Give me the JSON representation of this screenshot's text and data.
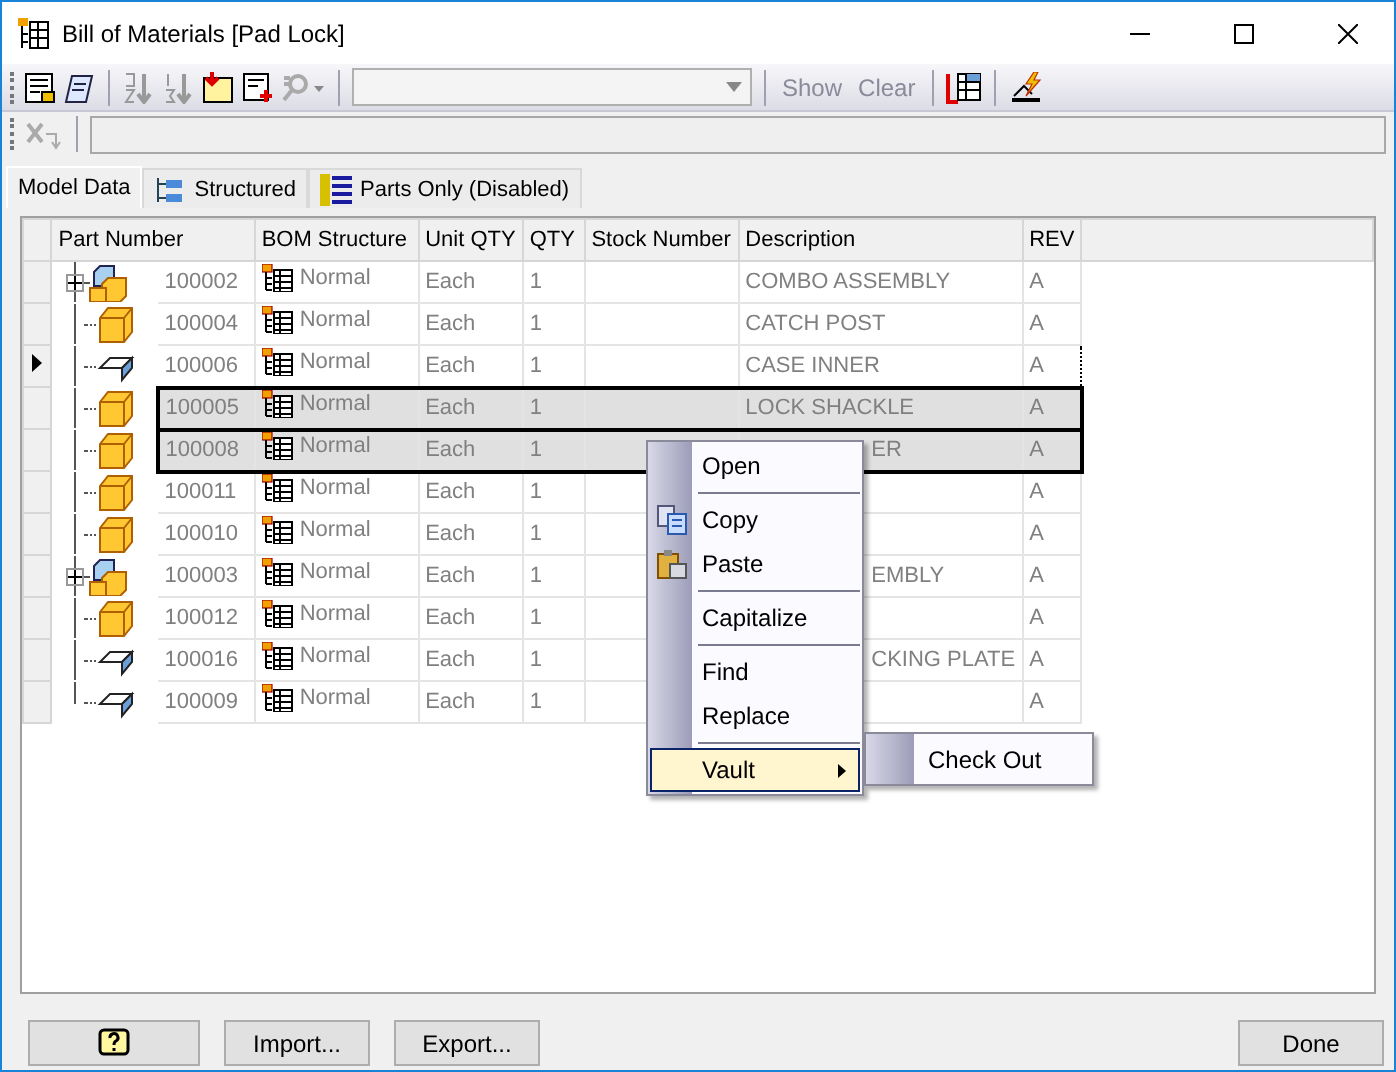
{
  "window": {
    "title": "Bill of Materials [Pad Lock]"
  },
  "toolbar": {
    "buttons": [
      {
        "label": "Show",
        "disabled": true
      },
      {
        "label": "Clear",
        "disabled": true
      }
    ]
  },
  "tabs": [
    {
      "label": "Model Data",
      "kind": "plain",
      "selected": true
    },
    {
      "label": "Structured",
      "kind": "tree",
      "selected": false
    },
    {
      "label": "Parts Only (Disabled)",
      "kind": "list",
      "selected": false
    }
  ],
  "table": {
    "columns": [
      "Part Number",
      "BOM Structure",
      "Unit QTY",
      "QTY",
      "Stock Number",
      "Description",
      "REV"
    ],
    "rows": [
      {
        "kind": "assembly",
        "expanded": false,
        "part": "100002",
        "bom": "Normal",
        "unit": "Each",
        "qty": "1",
        "description": "COMBO ASSEMBLY",
        "desc_covered": false,
        "rev": "A",
        "selected": false,
        "current": false
      },
      {
        "kind": "part",
        "part": "100004",
        "bom": "Normal",
        "unit": "Each",
        "qty": "1",
        "description": "CATCH POST",
        "desc_covered": false,
        "rev": "A",
        "selected": false,
        "current": false
      },
      {
        "kind": "sheet",
        "part": "100006",
        "bom": "Normal",
        "unit": "Each",
        "qty": "1",
        "description": "CASE INNER",
        "desc_covered": false,
        "rev": "A",
        "selected": false,
        "current": true
      },
      {
        "kind": "part",
        "part": "100005",
        "bom": "Normal",
        "unit": "Each",
        "qty": "1",
        "description": "LOCK SHACKLE",
        "desc_covered": false,
        "rev": "A",
        "selected": true,
        "current": false
      },
      {
        "kind": "part",
        "part": "100008",
        "bom": "Normal",
        "unit": "Each",
        "qty": "1",
        "description": "ER",
        "desc_covered": true,
        "rev": "A",
        "selected": true,
        "current": false
      },
      {
        "kind": "part",
        "part": "100011",
        "bom": "Normal",
        "unit": "Each",
        "qty": "1",
        "rev": "A",
        "selected": false,
        "current": false
      },
      {
        "kind": "part",
        "part": "100010",
        "bom": "Normal",
        "unit": "Each",
        "qty": "1",
        "rev": "A",
        "selected": false,
        "current": false
      },
      {
        "kind": "assembly",
        "expanded": false,
        "part": "100003",
        "bom": "Normal",
        "unit": "Each",
        "qty": "1",
        "description": "EMBLY",
        "desc_covered": true,
        "rev": "A",
        "selected": false,
        "current": false
      },
      {
        "kind": "part",
        "part": "100012",
        "bom": "Normal",
        "unit": "Each",
        "qty": "1",
        "rev": "A",
        "selected": false,
        "current": false
      },
      {
        "kind": "sheet",
        "part": "100016",
        "bom": "Normal",
        "unit": "Each",
        "qty": "1",
        "description": "CKING PLATE",
        "desc_covered": true,
        "rev": "A",
        "selected": false,
        "current": false
      },
      {
        "kind": "sheet",
        "part": "100009",
        "bom": "Normal",
        "unit": "Each",
        "qty": "1",
        "rev": "A",
        "selected": false,
        "current": false
      }
    ]
  },
  "context_menu": {
    "items": [
      {
        "kind": "item",
        "label": "Open",
        "highlighted": false
      },
      {
        "kind": "separator"
      },
      {
        "kind": "copy",
        "label": "Copy",
        "highlighted": false
      },
      {
        "kind": "paste",
        "label": "Paste",
        "highlighted": false
      },
      {
        "kind": "separator"
      },
      {
        "kind": "item",
        "label": "Capitalize",
        "highlighted": false
      },
      {
        "kind": "separator"
      },
      {
        "kind": "item",
        "label": "Find",
        "highlighted": false
      },
      {
        "kind": "item",
        "label": "Replace",
        "highlighted": false
      },
      {
        "kind": "separator"
      },
      {
        "kind": "submenu",
        "label": "Vault",
        "highlighted": true
      }
    ],
    "submenu": {
      "items": [
        "Check Out"
      ]
    }
  },
  "footer": {
    "buttons": [
      {
        "kind": "help"
      },
      {
        "kind": "text",
        "label": "Import..."
      },
      {
        "kind": "text",
        "label": "Export..."
      },
      {
        "kind": "spacer"
      },
      {
        "kind": "text",
        "label": "Done"
      }
    ]
  }
}
